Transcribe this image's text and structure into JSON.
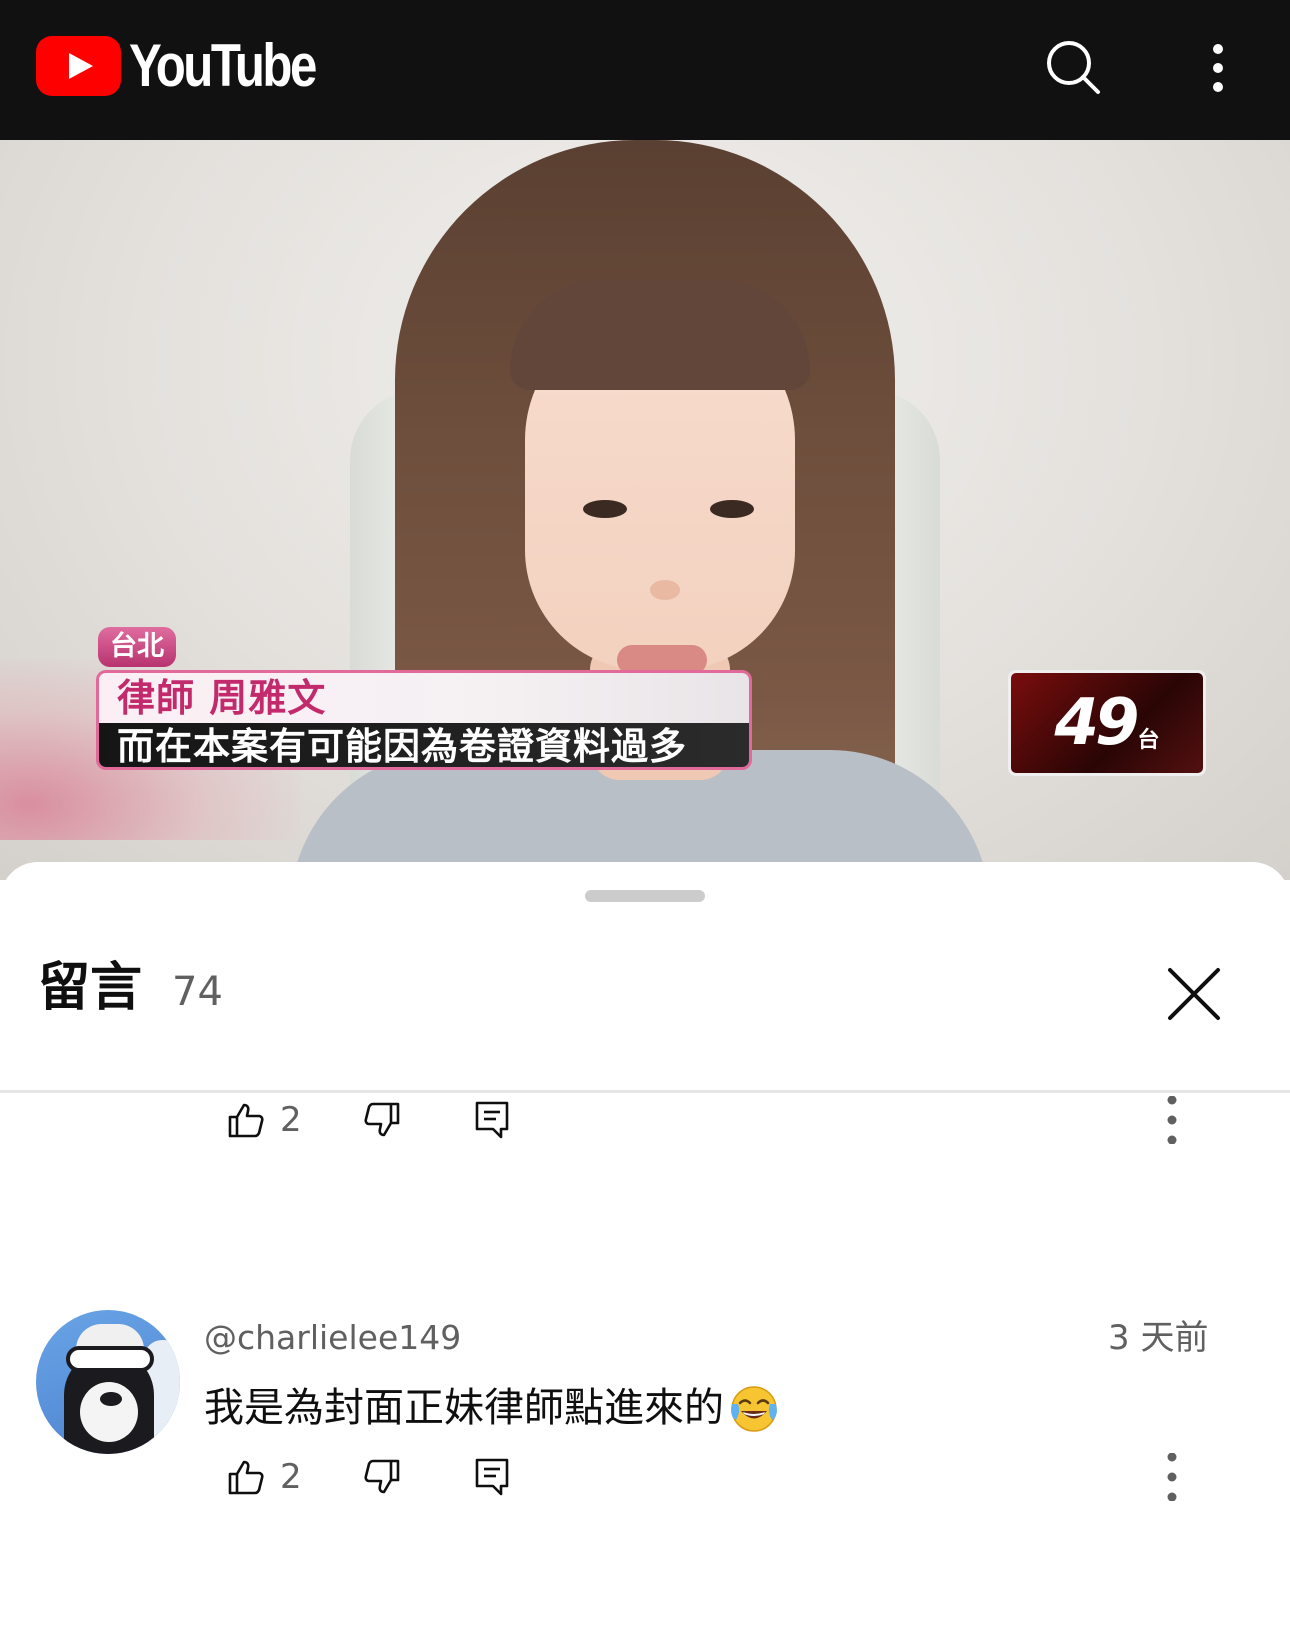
{
  "app": {
    "logo_text": "YouTube",
    "brand_red": "#ff0000",
    "topbar_color": "#111111"
  },
  "topbar": {
    "icons": [
      "search-icon",
      "more-vert-icon"
    ]
  },
  "video": {
    "location_tag": "台北",
    "lower_third_name": "律師  周雅文",
    "lower_third_quote": "而在本案有可能因為卷證資料過多",
    "channel_number": "49",
    "channel_suffix": "台"
  },
  "comments_panel": {
    "title": "留言",
    "count": "74",
    "close_icon": "close-icon"
  },
  "previous_comment_actions": {
    "like_count": "2"
  },
  "comment": {
    "author": "@charlielee149",
    "time": "3 天前",
    "text": "我是為封面正妹律師點進來的",
    "emoji": "face-with-tears-of-joy",
    "like_count": "2"
  },
  "colors": {
    "secondary_text": "#606060",
    "primary_text": "#0f0f0f",
    "divider": "#e5e5e5"
  }
}
